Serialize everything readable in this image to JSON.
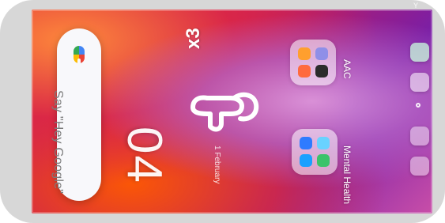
{
  "search": {
    "hint": "Say \"Hey Google\""
  },
  "clock": {
    "time": "04",
    "date": "1 February"
  },
  "folders": {
    "aac": {
      "label": "AAC"
    },
    "mental_health": {
      "label": "Mental Health"
    }
  },
  "gesture": {
    "tap_count_label": "x3",
    "icon": "hand-tap-icon"
  },
  "status": {
    "edge_signal": "Y"
  },
  "colors": {
    "frame_gray": "#d7d7d7",
    "wallpaper_orange": "#f04c1b",
    "wallpaper_magenta": "#c61b5a",
    "wallpaper_purple": "#7a1fa6"
  }
}
